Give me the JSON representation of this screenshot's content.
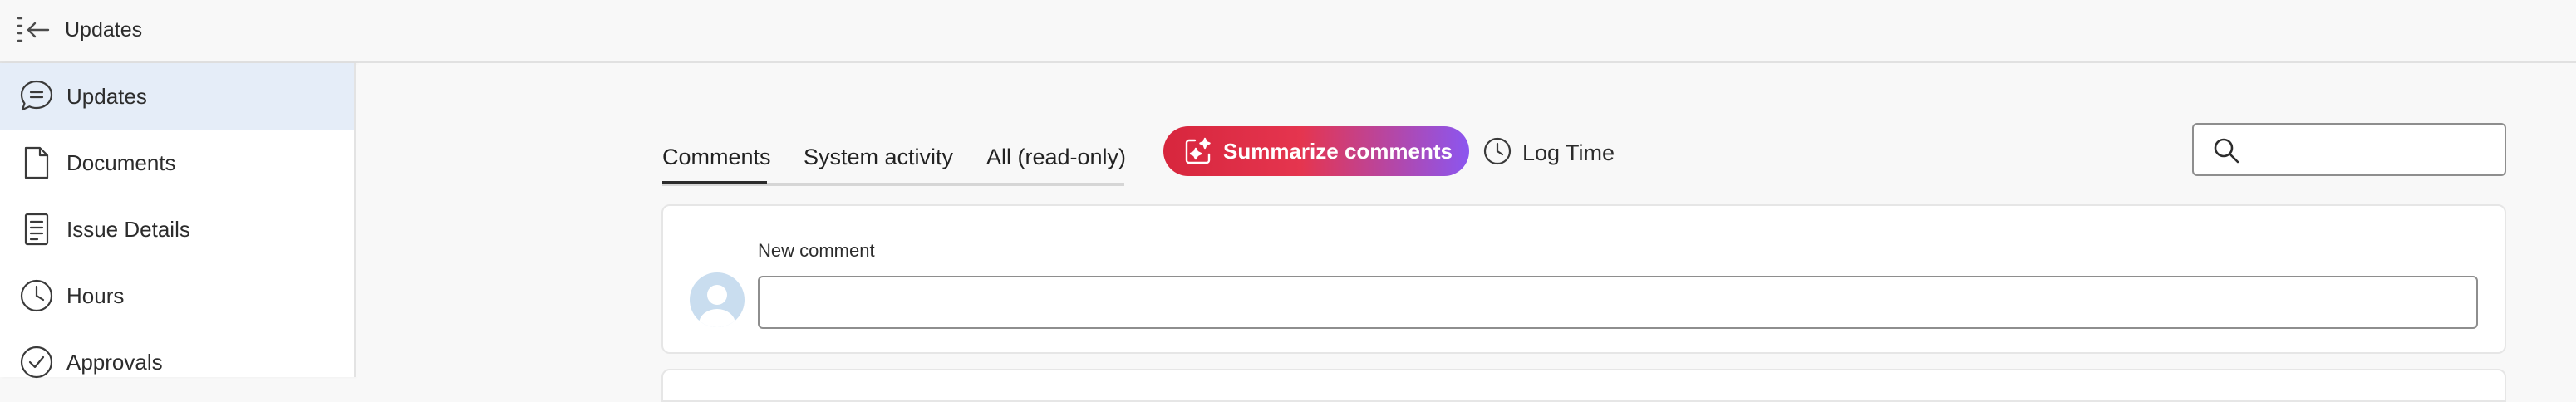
{
  "topbar": {
    "title": "Updates",
    "collapse_icon": "collapse-menu-icon"
  },
  "sidebar": {
    "items": [
      {
        "label": "Updates",
        "icon": "chat-bubble-icon",
        "active": true
      },
      {
        "label": "Documents",
        "icon": "document-icon",
        "active": false
      },
      {
        "label": "Issue Details",
        "icon": "details-icon",
        "active": false
      },
      {
        "label": "Hours",
        "icon": "clock-icon",
        "active": false
      },
      {
        "label": "Approvals",
        "icon": "check-circle-icon",
        "active": false
      }
    ],
    "active_bg": "#e5edf8"
  },
  "main": {
    "tabs": [
      {
        "label": "Comments",
        "selected": true
      },
      {
        "label": "System activity",
        "selected": false
      },
      {
        "label": "All (read-only)",
        "selected": false
      }
    ],
    "summarize": {
      "label": "Summarize comments",
      "icon": "ai-sparkle-icon",
      "gradient": [
        "#d7263d",
        "#8b56f0"
      ]
    },
    "log_time": {
      "label": "Log Time",
      "icon": "clock-icon"
    },
    "search": {
      "placeholder": "",
      "value": "",
      "icon": "search-icon"
    },
    "new_comment": {
      "label": "New comment",
      "value": "",
      "placeholder": "",
      "avatar_icon": "user-avatar-icon"
    }
  }
}
